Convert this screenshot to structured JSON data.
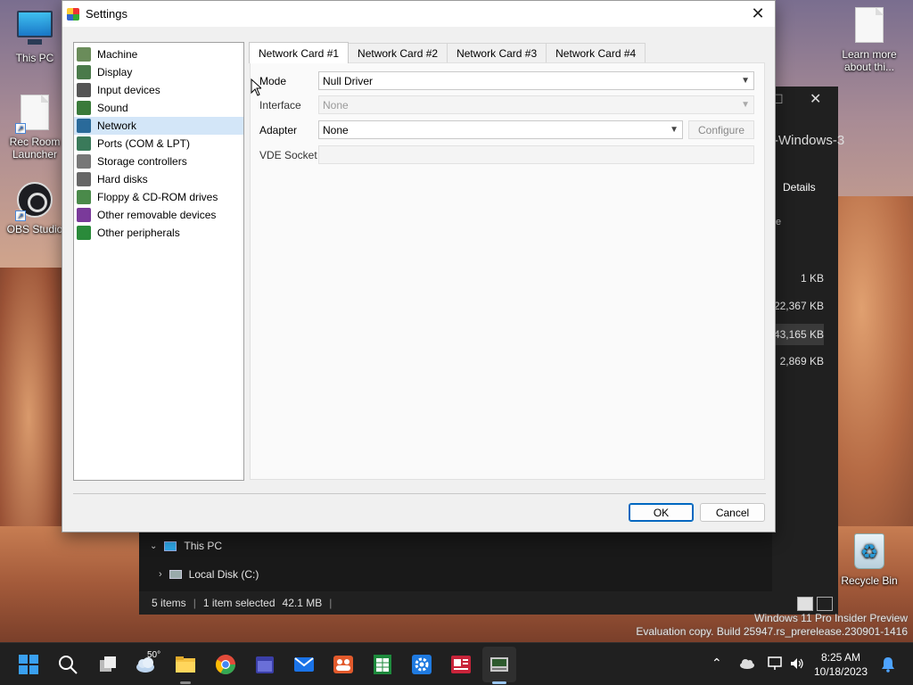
{
  "desktop": {
    "icons": [
      {
        "label": "This PC",
        "icon": "monitor-icon"
      },
      {
        "label": "Rec Room Launcher",
        "icon": "document-shortcut-icon"
      },
      {
        "label": "OBS Studio",
        "icon": "obs-icon"
      },
      {
        "label": "Learn more about thi...",
        "icon": "document-icon"
      },
      {
        "label": "Recycle Bin",
        "icon": "recycle-bin-icon"
      }
    ],
    "watermark_line1": "Windows 11 Pro Insider Preview",
    "watermark_line2": "Evaluation copy. Build 25947.rs_prerelease.230901-1416"
  },
  "explorer": {
    "tab_title": "-Windows-3",
    "details_label": "Details",
    "column_fragment": "e",
    "sizes": [
      "1 KB",
      "22,367 KB",
      "43,165 KB",
      "2,869 KB"
    ],
    "nav": {
      "this_pc": "This PC",
      "local_disk": "Local Disk (C:)"
    },
    "status": {
      "items": "5 items",
      "selected": "1 item selected",
      "size": "42.1 MB"
    }
  },
  "dialog": {
    "title": "Settings",
    "close_glyph": "✕",
    "categories": [
      {
        "label": "Machine",
        "icon": "machine-icon",
        "color": "#6a8c5a"
      },
      {
        "label": "Display",
        "icon": "display-icon",
        "color": "#4a7a4a"
      },
      {
        "label": "Input devices",
        "icon": "keyboard-icon",
        "color": "#555555"
      },
      {
        "label": "Sound",
        "icon": "speaker-icon",
        "color": "#3a7a3a"
      },
      {
        "label": "Network",
        "icon": "network-icon",
        "color": "#2a6a9a"
      },
      {
        "label": "Ports (COM & LPT)",
        "icon": "port-icon",
        "color": "#3a7a5a"
      },
      {
        "label": "Storage controllers",
        "icon": "storage-icon",
        "color": "#777777"
      },
      {
        "label": "Hard disks",
        "icon": "hard-disk-icon",
        "color": "#666666"
      },
      {
        "label": "Floppy & CD-ROM drives",
        "icon": "floppy-icon",
        "color": "#4a8a4a"
      },
      {
        "label": "Other removable devices",
        "icon": "removable-device-icon",
        "color": "#7a3a9a"
      },
      {
        "label": "Other peripherals",
        "icon": "peripheral-icon",
        "color": "#2a8a3a"
      }
    ],
    "selected_category": "Network",
    "tabs": [
      "Network Card #1",
      "Network Card #2",
      "Network Card #3",
      "Network Card #4"
    ],
    "active_tab": "Network Card #1",
    "fields": {
      "mode": {
        "label": "Mode",
        "value": "Null Driver"
      },
      "interface": {
        "label": "Interface",
        "value": "None"
      },
      "adapter": {
        "label": "Adapter",
        "value": "None"
      },
      "configure_label": "Configure",
      "vde_socket": {
        "label": "VDE Socket",
        "value": ""
      }
    },
    "ok_label": "OK",
    "cancel_label": "Cancel"
  },
  "taskbar": {
    "weather_temp": "50°",
    "time": "8:25 AM",
    "date": "10/18/2023",
    "apps": [
      "start-icon",
      "search-icon",
      "task-view-icon",
      "weather-icon",
      "file-explorer-icon",
      "chrome-icon",
      "calendar-icon",
      "mail-icon",
      "teams-icon",
      "spreadsheet-icon",
      "settings-gear-icon",
      "news-icon",
      "86box-icon"
    ]
  }
}
